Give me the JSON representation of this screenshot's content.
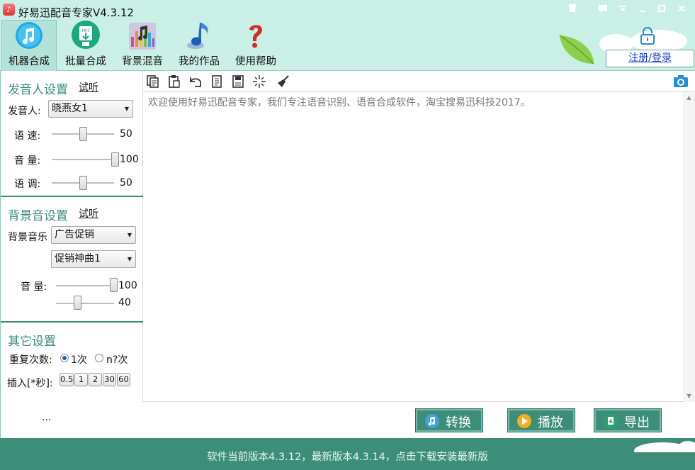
{
  "window": {
    "title": "好易迅配音专家V4.3.12",
    "controls": [
      "shirt-icon",
      "message-icon",
      "dropdown-icon",
      "minimize-icon",
      "maximize-icon",
      "close-icon"
    ]
  },
  "toolbar": {
    "items": [
      {
        "label": "机器合成",
        "icon": "music-note-icon",
        "active": true
      },
      {
        "label": "批量合成",
        "icon": "mp3-download-icon",
        "active": false
      },
      {
        "label": "背景混音",
        "icon": "equalizer-note-icon",
        "active": false
      },
      {
        "label": "我的作品",
        "icon": "blue-note-icon",
        "active": false
      },
      {
        "label": "使用帮助",
        "icon": "question-mark-icon",
        "active": false
      }
    ],
    "login_label": "注册/登录"
  },
  "speaker_settings": {
    "title": "发音人设置",
    "preview_label": "试听",
    "speaker_label": "发音人:",
    "speaker_value": "晓燕女1",
    "speed_label": "语 速:",
    "speed_value": "50",
    "volume_label": "音 量:",
    "volume_value": "100",
    "pitch_label": "语 调:",
    "pitch_value": "50"
  },
  "bg_settings": {
    "title": "背景音设置",
    "preview_label": "试听",
    "music_label": "背景音乐",
    "category_value": "广告促销",
    "track_value": "促销神曲1",
    "volume_label": "音 量:",
    "volume_value": "100",
    "second_value": "40"
  },
  "other_settings": {
    "title": "其它设置",
    "repeat_label": "重复次数:",
    "repeat_option_1": "1次",
    "repeat_option_n": "n?次",
    "insert_label": "插入[*秒]:",
    "pause_buttons": [
      "0.5",
      "1",
      "2",
      "30",
      "60"
    ]
  },
  "editor": {
    "toolbar_icons": [
      "copy-icon",
      "paste-icon",
      "undo-icon",
      "document-icon",
      "save-icon",
      "sparkle-icon",
      "broom-icon"
    ],
    "camera_icon": "camera-icon",
    "text": "欢迎使用好易迅配音专家，我们专注语音识别、语音合成软件，淘宝搜易迅科技2017。"
  },
  "actions": {
    "ellipsis": "...",
    "convert_label": "转换",
    "play_label": "播放",
    "export_label": "导出"
  },
  "status": {
    "text": "软件当前版本4.3.12，最新版本4.3.14，点击下载安装最新版"
  },
  "colors": {
    "header_bg": "#c9efe6",
    "accent": "#3d8e79",
    "section_title": "#3a8c7a",
    "link_blue": "#1a3fd6"
  }
}
